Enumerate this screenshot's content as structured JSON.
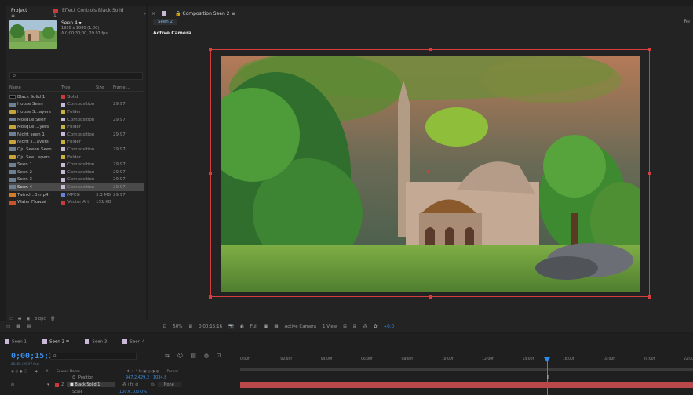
{
  "project": {
    "tab_label": "Project",
    "tab2_label": "Effect Controls Black Solid 1",
    "selected_name": "Seen 4",
    "selected_dims": "1920 x 1080 (1.00)",
    "selected_duration": "Δ 0;00;30;00, 29.97 fps",
    "search_placeholder": "ρ.",
    "columns": [
      "Name",
      "Type",
      "Size",
      "Frame ..."
    ],
    "items": [
      {
        "name": "Black Solid 1",
        "type": "Solid",
        "size": "",
        "fr": "",
        "icon": "solid",
        "label_color": "#c93a3a"
      },
      {
        "name": "House Seen",
        "type": "Composition",
        "size": "",
        "fr": "29.97",
        "icon": "comp",
        "label_color": "#c9b8d8"
      },
      {
        "name": "House S...ayers",
        "type": "Folder",
        "size": "",
        "fr": "",
        "icon": "folder",
        "label_color": "#c9b23a"
      },
      {
        "name": "Mosque Seen",
        "type": "Composition",
        "size": "",
        "fr": "29.97",
        "icon": "comp",
        "label_color": "#c9b8d8"
      },
      {
        "name": "Mosque ...yers",
        "type": "Folder",
        "size": "",
        "fr": "",
        "icon": "folder",
        "label_color": "#c9b23a"
      },
      {
        "name": "Night seen 1",
        "type": "Composition",
        "size": "",
        "fr": "29.97",
        "icon": "comp",
        "label_color": "#c9b8d8"
      },
      {
        "name": "Night s...ayers",
        "type": "Folder",
        "size": "",
        "fr": "",
        "icon": "folder",
        "label_color": "#c9b23a"
      },
      {
        "name": "Oju Seeen Seen",
        "type": "Composition",
        "size": "",
        "fr": "29.97",
        "icon": "comp",
        "label_color": "#c9b8d8"
      },
      {
        "name": "Oju See...ayers",
        "type": "Folder",
        "size": "",
        "fr": "",
        "icon": "folder",
        "label_color": "#c9b23a"
      },
      {
        "name": "Seen 1",
        "type": "Composition",
        "size": "",
        "fr": "29.97",
        "icon": "comp",
        "label_color": "#c9b8d8"
      },
      {
        "name": "Seen 2",
        "type": "Composition",
        "size": "",
        "fr": "29.97",
        "icon": "comp",
        "label_color": "#c9b8d8"
      },
      {
        "name": "Seen 3",
        "type": "Composition",
        "size": "",
        "fr": "29.97",
        "icon": "comp",
        "label_color": "#c9b8d8"
      },
      {
        "name": "Seen 4",
        "type": "Composition",
        "size": "",
        "fr": "29.97",
        "icon": "comp",
        "label_color": "#c9b8d8",
        "selected": true
      },
      {
        "name": "Twinkl...3.mp4",
        "type": "MPEG",
        "size": "3.3 MB",
        "fr": "29.97",
        "icon": "video",
        "label_color": "#6a82d6"
      },
      {
        "name": "Water Flow.ai",
        "type": "Vector Art",
        "size": "151 KB",
        "fr": "",
        "icon": "vector",
        "label_color": "#c93a3a"
      }
    ],
    "bpc_label": "8 bpc"
  },
  "composition": {
    "tab_label": "Composition Seen 2",
    "subtab": "Seen 2",
    "right_clip": "Re",
    "active_camera": "Active Camera",
    "footer": {
      "zoom": "50%",
      "timecode": "0;00;15;16",
      "resolution": "Full",
      "camera": "Active Camera",
      "view": "1 View",
      "exposure": "+0.0"
    }
  },
  "timeline": {
    "tabs": [
      "Seen 1",
      "Seen 2",
      "Seen 3",
      "Seen 4"
    ],
    "active_tab": "Seen 2",
    "timecode": "0;00;15;16",
    "fps_sub": "00466 (29.97 fps)",
    "search_placeholder": "ρ.",
    "ruler_ticks": [
      "0:00f",
      "02:00f",
      "04:00f",
      "06:00f",
      "08:00f",
      "10:00f",
      "12:00f",
      "14:00f",
      "16:00f",
      "18:00f",
      "20:00f",
      "22:00f"
    ],
    "col_source": "Source Name",
    "col_parent": "Parent",
    "row_position_label": "Position",
    "row_position_value": "947.2,429.2 , 1034.8",
    "layer_index": "2",
    "layer_name": "Black Solid 1",
    "layer_parent": "None",
    "row_scale_label": "Scale",
    "row_scale_value": "100.0,100.0%"
  },
  "colors": {
    "accent": "#2d8ceb",
    "selection_red": "#d5403f",
    "layer_bar": "#b8484a"
  }
}
